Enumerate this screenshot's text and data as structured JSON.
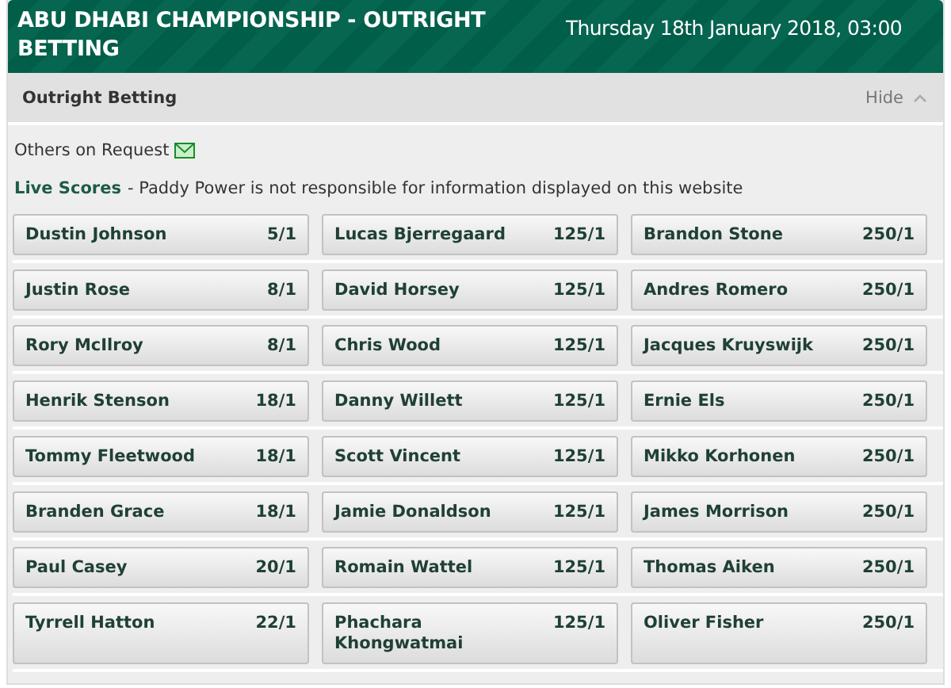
{
  "header": {
    "title": "ABU DHABI CHAMPIONSHIP - OUTRIGHT BETTING",
    "date": "Thursday 18th January 2018, 03:00"
  },
  "section": {
    "title": "Outright Betting",
    "toggle": "Hide"
  },
  "notes": {
    "request": "Others on Request",
    "live_label": "Live Scores",
    "live_text": "- Paddy Power is not responsible for information displayed on this website"
  },
  "rows": [
    [
      {
        "name": "Dustin Johnson",
        "odds": "5/1"
      },
      {
        "name": "Lucas Bjerregaard",
        "odds": "125/1"
      },
      {
        "name": "Brandon Stone",
        "odds": "250/1"
      }
    ],
    [
      {
        "name": "Justin Rose",
        "odds": "8/1"
      },
      {
        "name": "David Horsey",
        "odds": "125/1"
      },
      {
        "name": "Andres Romero",
        "odds": "250/1"
      }
    ],
    [
      {
        "name": "Rory McIlroy",
        "odds": "8/1"
      },
      {
        "name": "Chris Wood",
        "odds": "125/1"
      },
      {
        "name": "Jacques Kruyswijk",
        "odds": "250/1"
      }
    ],
    [
      {
        "name": "Henrik Stenson",
        "odds": "18/1"
      },
      {
        "name": "Danny Willett",
        "odds": "125/1"
      },
      {
        "name": "Ernie Els",
        "odds": "250/1"
      }
    ],
    [
      {
        "name": "Tommy Fleetwood",
        "odds": "18/1"
      },
      {
        "name": "Scott Vincent",
        "odds": "125/1"
      },
      {
        "name": "Mikko Korhonen",
        "odds": "250/1"
      }
    ],
    [
      {
        "name": "Branden Grace",
        "odds": "18/1"
      },
      {
        "name": "Jamie Donaldson",
        "odds": "125/1"
      },
      {
        "name": "James Morrison",
        "odds": "250/1"
      }
    ],
    [
      {
        "name": "Paul Casey",
        "odds": "20/1"
      },
      {
        "name": "Romain Wattel",
        "odds": "125/1"
      },
      {
        "name": "Thomas Aiken",
        "odds": "250/1"
      }
    ],
    [
      {
        "name": "Tyrrell Hatton",
        "odds": "22/1"
      },
      {
        "name": "Phachara Khongwatmai",
        "odds": "125/1"
      },
      {
        "name": "Oliver Fisher",
        "odds": "250/1"
      }
    ]
  ]
}
